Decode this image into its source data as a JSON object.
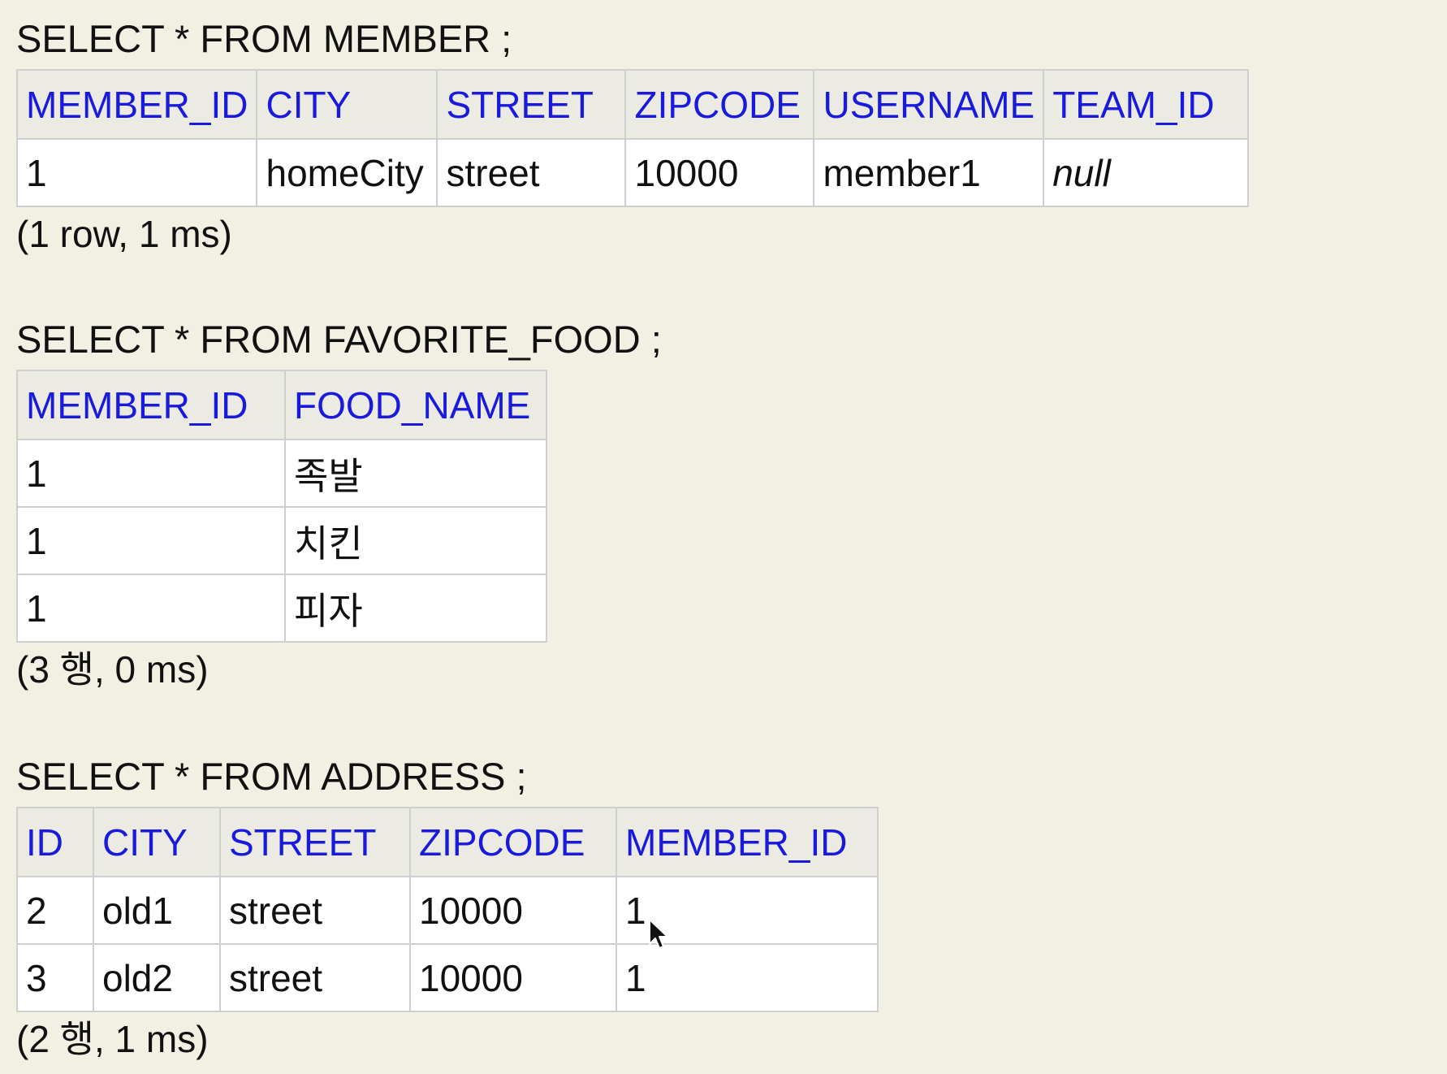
{
  "queries": [
    {
      "sql": "SELECT * FROM MEMBER ;",
      "columns": [
        "MEMBER_ID",
        "CITY",
        "STREET",
        "ZIPCODE",
        "USERNAME",
        "TEAM_ID"
      ],
      "rows": [
        [
          "1",
          "homeCity",
          "street",
          "10000",
          "member1",
          "null"
        ]
      ],
      "status": "(1 row, 1 ms)"
    },
    {
      "sql": "SELECT * FROM FAVORITE_FOOD ;",
      "columns": [
        "MEMBER_ID",
        "FOOD_NAME"
      ],
      "rows": [
        [
          "1",
          "족발"
        ],
        [
          "1",
          "치킨"
        ],
        [
          "1",
          "피자"
        ]
      ],
      "status": "(3 행, 0 ms)"
    },
    {
      "sql": "SELECT * FROM ADDRESS ;",
      "columns": [
        "ID",
        "CITY",
        "STREET",
        "ZIPCODE",
        "MEMBER_ID"
      ],
      "rows": [
        [
          "2",
          "old1",
          "street",
          "10000",
          "1"
        ],
        [
          "3",
          "old2",
          "street",
          "10000",
          "1"
        ]
      ],
      "status": "(2 행, 1 ms)"
    }
  ],
  "colors": {
    "background": "#f2f0e3",
    "header_text": "#1a1adc",
    "header_bg": "#ebebe4"
  },
  "icons": {
    "cursor": "mouse-pointer-icon"
  }
}
